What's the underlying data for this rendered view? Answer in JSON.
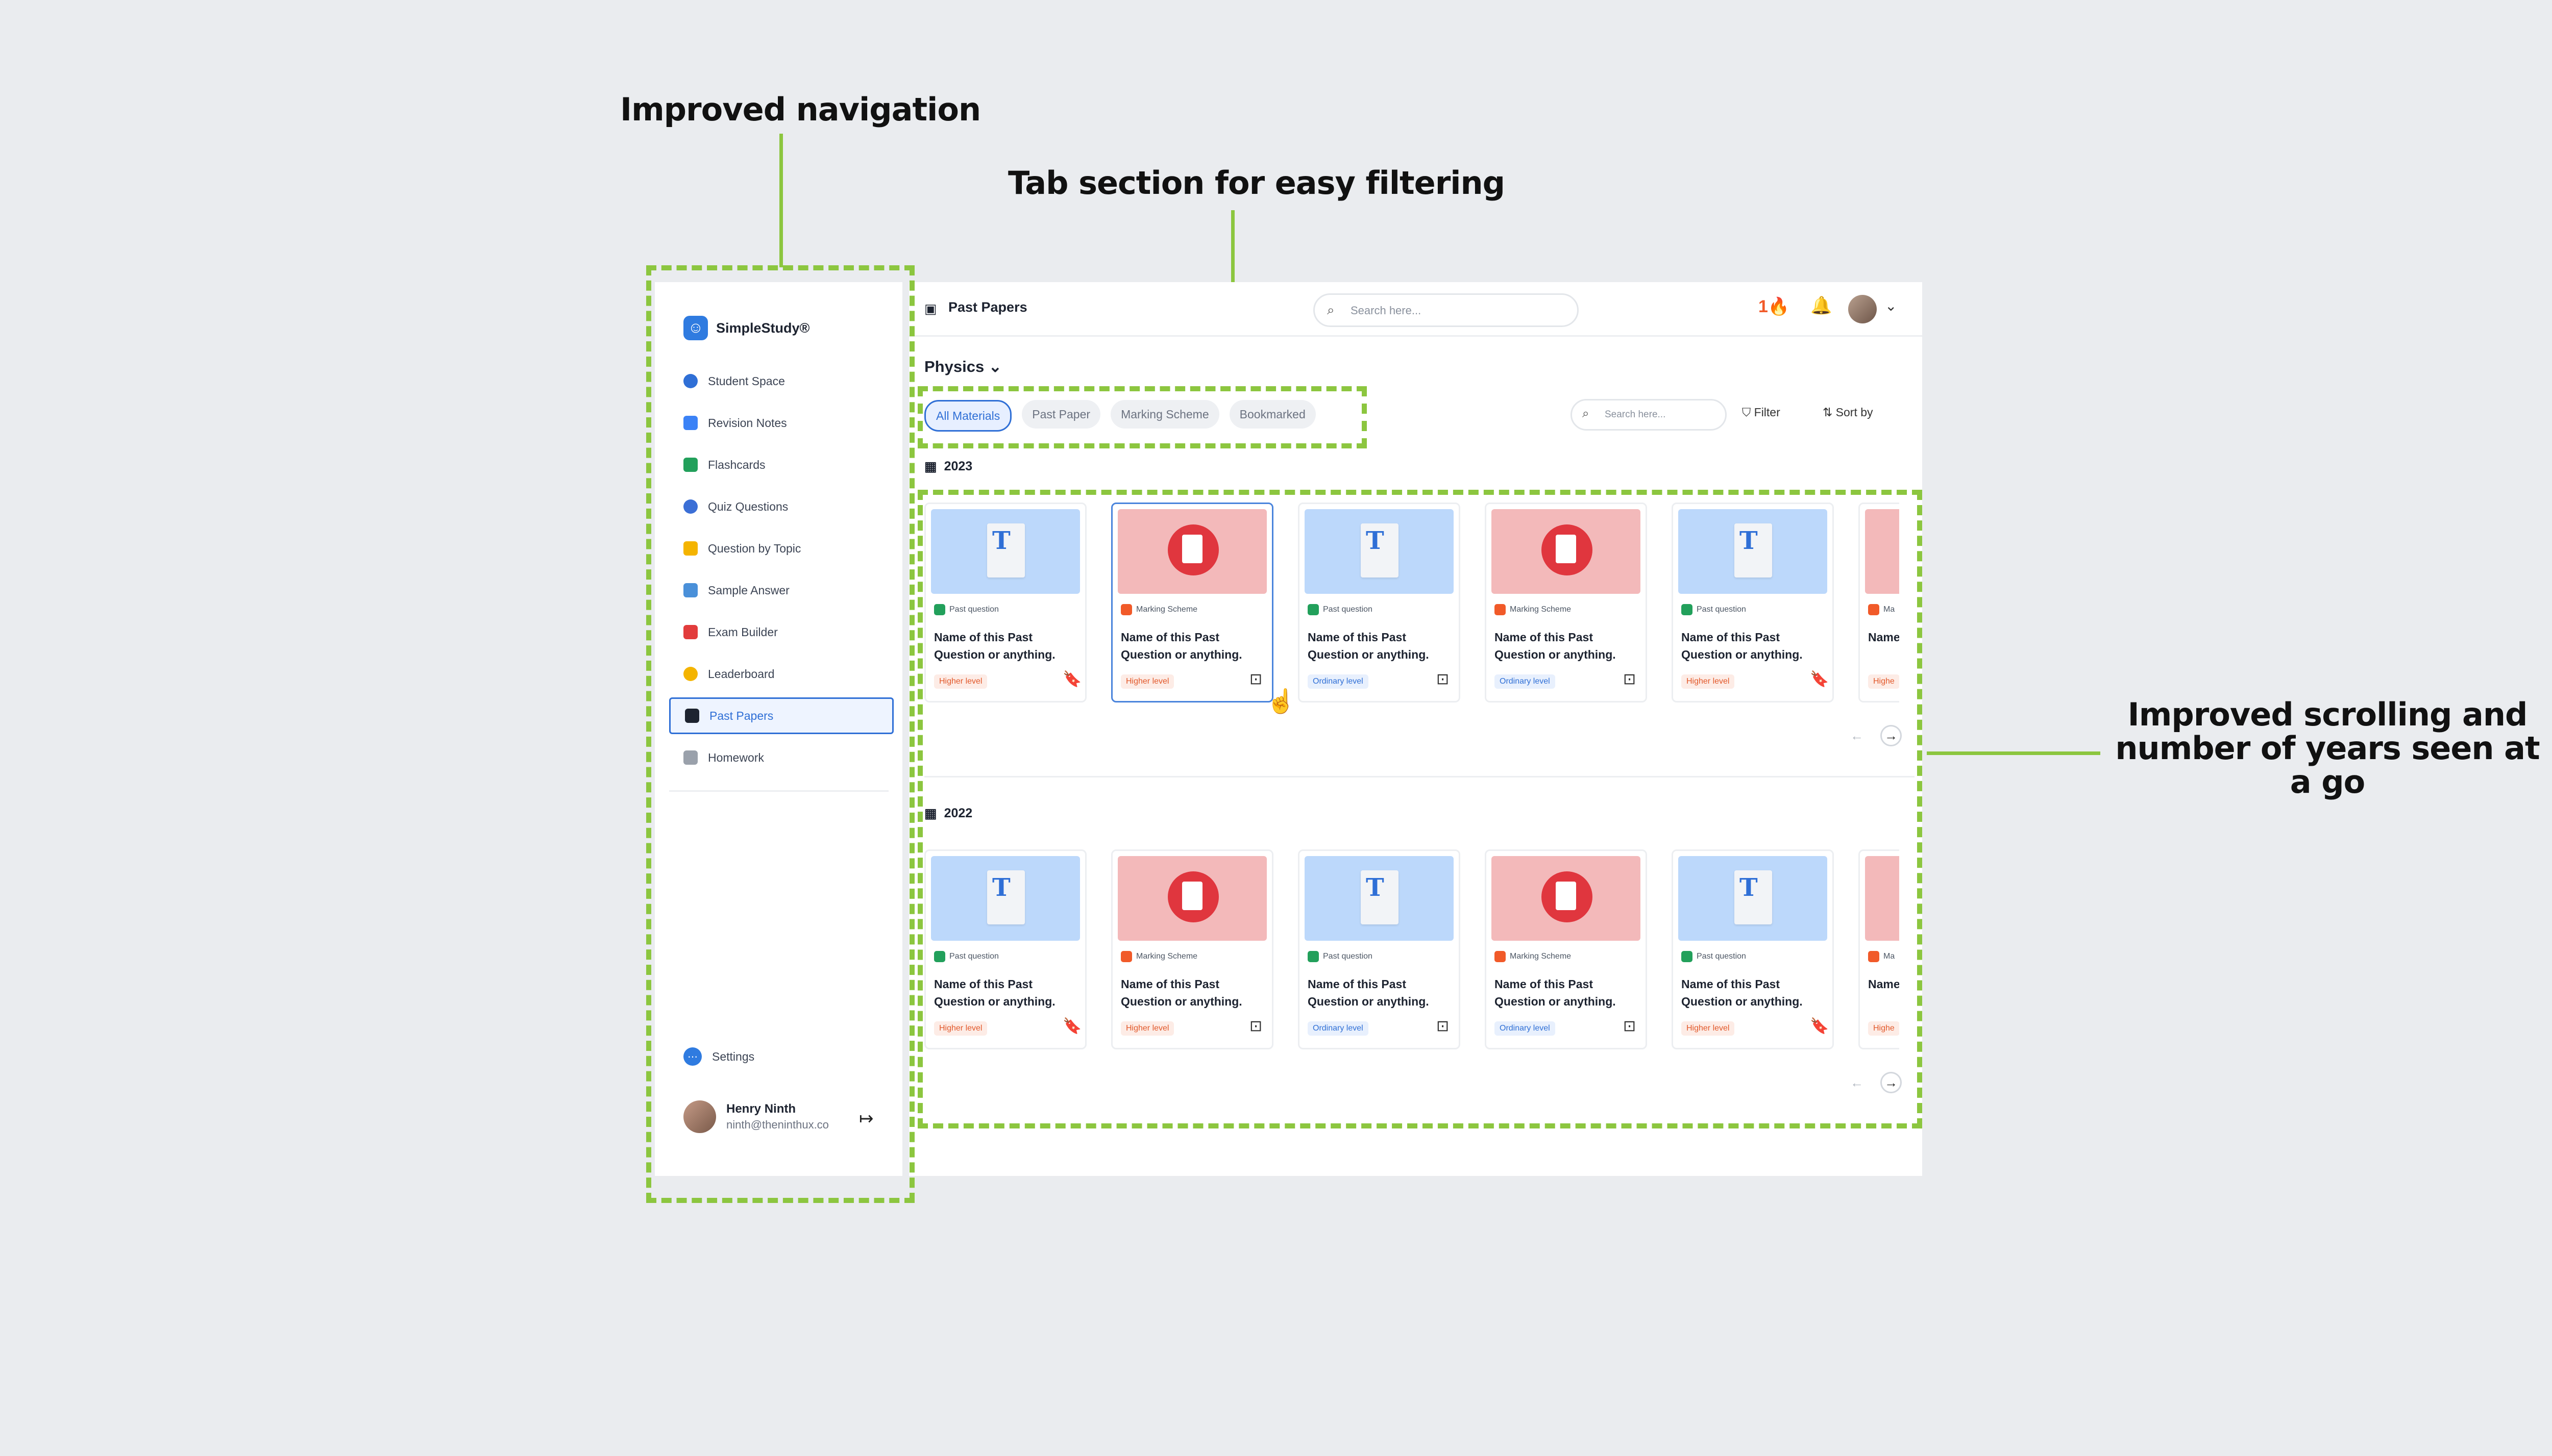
{
  "annotations": {
    "navigation": "Improved navigation",
    "tabs": "Tab section for easy filtering",
    "scrolling_line1": "Improved scrolling and",
    "scrolling_line2": "number of years seen at a go"
  },
  "sidebar": {
    "brand": "SimpleStudy®",
    "items": [
      {
        "label": "Student Space",
        "icon": "student-space-icon",
        "color": "#2f6fd6"
      },
      {
        "label": "Revision Notes",
        "icon": "notes-icon",
        "color": "#3b82f6"
      },
      {
        "label": "Flashcards",
        "icon": "flashcards-icon",
        "color": "#22a05b"
      },
      {
        "label": "Quiz Questions",
        "icon": "quiz-icon",
        "color": "#3b6fd6"
      },
      {
        "label": "Question by Topic",
        "icon": "topic-icon",
        "color": "#f4b400"
      },
      {
        "label": "Sample Answer",
        "icon": "sample-answer-icon",
        "color": "#4a90d9"
      },
      {
        "label": "Exam Builder",
        "icon": "exam-builder-icon",
        "color": "#e23c3c"
      },
      {
        "label": "Leaderboard",
        "icon": "leaderboard-icon",
        "color": "#f4b400"
      },
      {
        "label": "Past Papers",
        "icon": "past-papers-icon",
        "color": "#1d2330"
      },
      {
        "label": "Homework",
        "icon": "homework-icon",
        "color": "#9aa1ab"
      }
    ],
    "settings": "Settings",
    "user": {
      "name": "Henry Ninth",
      "email": "ninth@theninthux.co"
    }
  },
  "topbar": {
    "title": "Past Papers",
    "search_placeholder": "Search here...",
    "streak": "1"
  },
  "content": {
    "subject": "Physics",
    "tabs": [
      "All Materials",
      "Past Paper",
      "Marking Scheme",
      "Bookmarked"
    ],
    "filter_search_placeholder": "Search here...",
    "filter_label": "Filter",
    "sort_label": "Sort by",
    "years": [
      "2023",
      "2022"
    ],
    "card_title": "Name of this Past Question or anything.",
    "cards": [
      {
        "type": "Past question",
        "level": "Higher level",
        "bookmarked": true
      },
      {
        "type": "Marking Scheme",
        "level": "Higher level",
        "bookmarked": false
      },
      {
        "type": "Past question",
        "level": "Ordinary level",
        "bookmarked": false
      },
      {
        "type": "Marking Scheme",
        "level": "Ordinary level",
        "bookmarked": false
      },
      {
        "type": "Past question",
        "level": "Higher level",
        "bookmarked": true
      }
    ],
    "partial_card": {
      "type": "Ma",
      "title": "Name of this Past Ques",
      "level": "Highe"
    }
  },
  "colors": {
    "accent": "#2f6fd6",
    "annotation_green": "#8cc63f",
    "past_question": "#22a05b",
    "marking_scheme": "#f15a29"
  }
}
